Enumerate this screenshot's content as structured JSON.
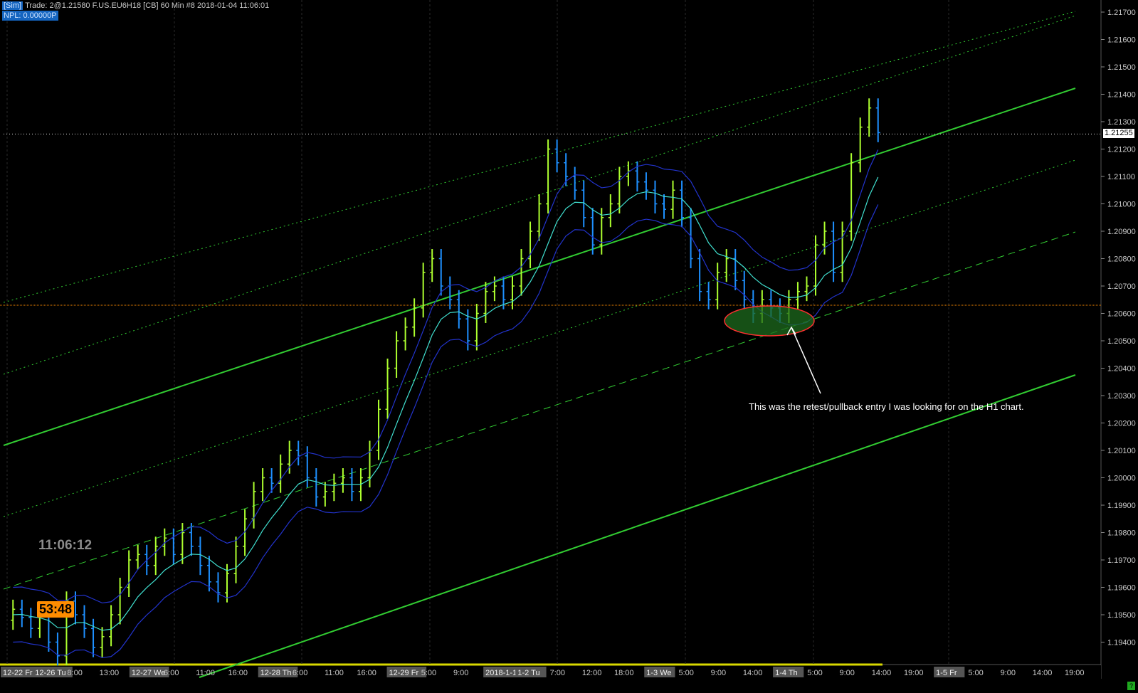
{
  "header": {
    "sim_badge": "[Sim]",
    "info": "Trade: 2@1.21580  F.US.EU6H18 [CB]  60 Min   #8 2018-01-04 11:06:01",
    "npl": "NPL: 0.00000P"
  },
  "clock": "11:06:12",
  "bar_timer": "53:48",
  "annotation": "This was the retest/pullback entry I was looking for on the H1 chart.",
  "last_price": "1.21255",
  "corner_indicator": "?",
  "price_axis": {
    "labels": [
      "1.21700",
      "1.21600",
      "1.21500",
      "1.21400",
      "1.21300",
      "1.21200",
      "1.21100",
      "1.21000",
      "1.20900",
      "1.20800",
      "1.20700",
      "1.20600",
      "1.20500",
      "1.20400",
      "1.20300",
      "1.20200",
      "1.20100",
      "1.20000",
      "1.19900",
      "1.19800",
      "1.19700",
      "1.19600",
      "1.19500",
      "1.19400"
    ]
  },
  "time_axis": {
    "labels": [
      {
        "text": "12-22 Fr",
        "boxed": true
      },
      {
        "text": "12-26 Tu",
        "boxed": true
      },
      {
        "text": "8:00",
        "boxed": false
      },
      {
        "text": "13:00",
        "boxed": false
      },
      {
        "text": "12-27 We",
        "boxed": true
      },
      {
        "text": "6:00",
        "boxed": false
      },
      {
        "text": "11:00",
        "boxed": false
      },
      {
        "text": "16:00",
        "boxed": false
      },
      {
        "text": "12-28 Th",
        "boxed": true
      },
      {
        "text": "6:00",
        "boxed": false
      },
      {
        "text": "11:00",
        "boxed": false
      },
      {
        "text": "16:00",
        "boxed": false
      },
      {
        "text": "12-29 Fr",
        "boxed": true
      },
      {
        "text": "5:00",
        "boxed": false
      },
      {
        "text": "9:00",
        "boxed": false
      },
      {
        "text": "2018-1-1 Mo",
        "boxed": true
      },
      {
        "text": "1-2 Tu",
        "boxed": true
      },
      {
        "text": "7:00",
        "boxed": false
      },
      {
        "text": "12:00",
        "boxed": false
      },
      {
        "text": "18:00",
        "boxed": false
      },
      {
        "text": "1-3 We",
        "boxed": true
      },
      {
        "text": "5:00",
        "boxed": false
      },
      {
        "text": "9:00",
        "boxed": false
      },
      {
        "text": "14:00",
        "boxed": false
      },
      {
        "text": "1-4 Th",
        "boxed": true
      },
      {
        "text": "5:00",
        "boxed": false
      },
      {
        "text": "9:00",
        "boxed": false
      },
      {
        "text": "14:00",
        "boxed": false
      },
      {
        "text": "19:00",
        "boxed": false
      },
      {
        "text": "1-5 Fr",
        "boxed": true
      },
      {
        "text": "5:00",
        "boxed": false
      },
      {
        "text": "9:00",
        "boxed": false
      },
      {
        "text": "14:00",
        "boxed": false
      },
      {
        "text": "19:00",
        "boxed": false
      }
    ]
  },
  "colors": {
    "background": "#000000",
    "up_bar": "#adff2f",
    "down_bar": "#1e90ff",
    "channel": "#32cd32",
    "ema": "#40e0d0",
    "band": "#2233cc",
    "level_line": "#ff8c00",
    "highlight_fill": "#1e6b1e",
    "highlight_stroke": "#ff3030"
  },
  "chart_data": {
    "type": "ohlc",
    "instrument": "F.US.EU6H18",
    "timeframe": "60 Min",
    "ylim": [
      1.1937,
      1.2175
    ],
    "last_price": 1.21255,
    "horizontal_level": 1.2063,
    "path": [
      1.1948,
      1.1952,
      1.1949,
      1.1945,
      1.195,
      1.194,
      1.1935,
      1.1955,
      1.195,
      1.1945,
      1.1938,
      1.1942,
      1.195,
      1.196,
      1.197,
      1.1972,
      1.1968,
      1.1975,
      1.1978,
      1.1972,
      1.198,
      1.1975,
      1.1968,
      1.1962,
      1.1958,
      1.1965,
      1.1975,
      1.1985,
      1.1995,
      1.2,
      1.1998,
      1.2005,
      1.201,
      1.2008,
      1.2,
      1.1993,
      1.1995,
      1.1998,
      1.2,
      1.1995,
      1.2,
      1.201,
      1.2025,
      1.204,
      1.205,
      1.2055,
      1.2062,
      1.2075,
      1.208,
      1.207,
      1.2065,
      1.2058,
      1.205,
      1.206,
      1.2068,
      1.207,
      1.2065,
      1.207,
      1.208,
      1.209,
      1.21,
      1.212,
      1.2115,
      1.211,
      1.2105,
      1.2095,
      1.2085,
      1.2095,
      1.21,
      1.211,
      1.2112,
      1.2108,
      1.2105,
      1.21,
      1.2098,
      1.2105,
      1.2095,
      1.208,
      1.2068,
      1.2065,
      1.2075,
      1.208,
      1.2072,
      1.2065,
      1.206,
      1.2065,
      1.2062,
      1.206,
      1.2065,
      1.2068,
      1.207,
      1.2085,
      1.209,
      1.2075,
      1.209,
      1.2115,
      1.2128,
      1.2135,
      1.2126
    ]
  }
}
